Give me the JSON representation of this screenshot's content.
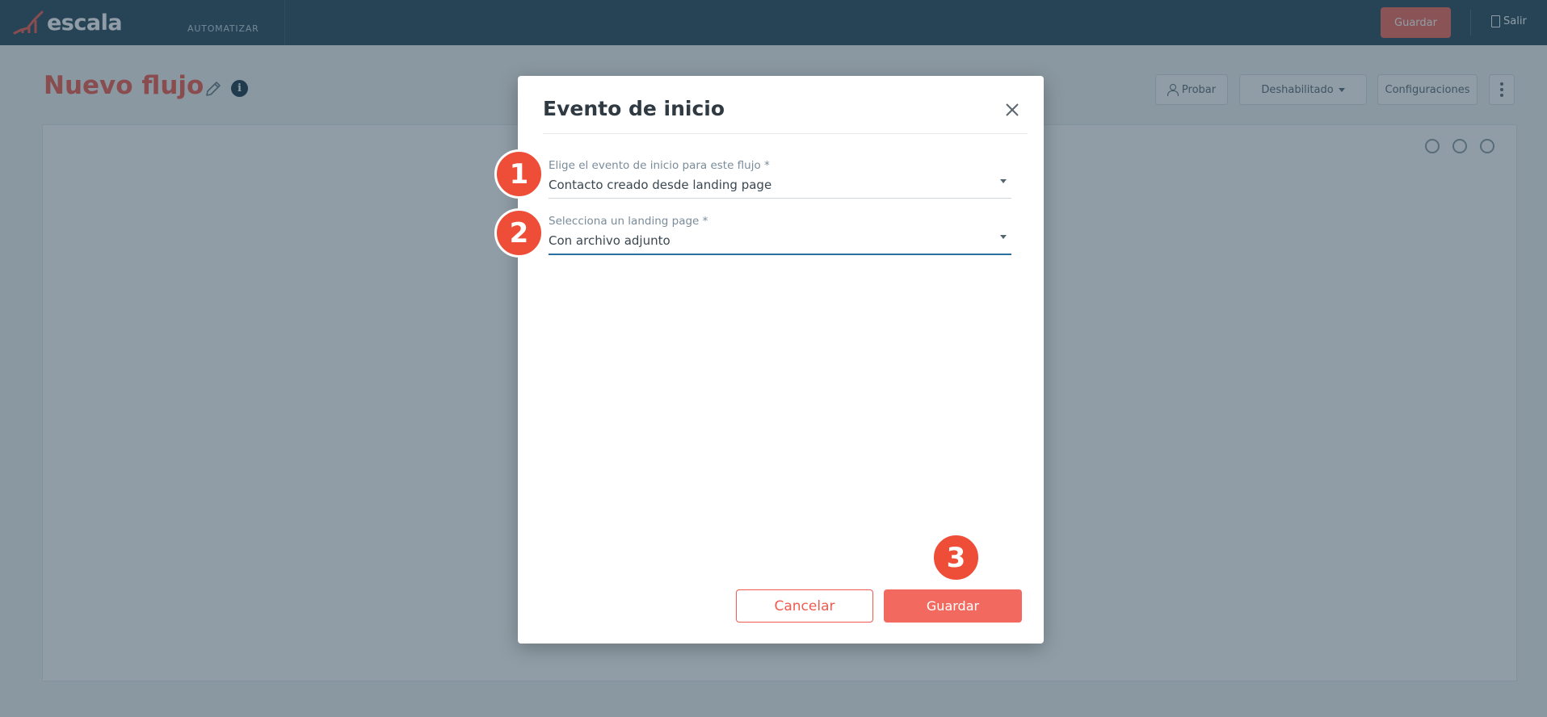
{
  "app": {
    "brand": "escala",
    "nav_item": "AUTOMATIZAR",
    "top_save_label": "Guardar",
    "logout_label": "Salir"
  },
  "page": {
    "title": "Nuevo flujo",
    "info_icon_glyph": "i",
    "buttons": {
      "probar": "Probar",
      "estado": "Deshabilitado",
      "config": "Configuraciones"
    }
  },
  "modal": {
    "title": "Evento de inicio",
    "fields": [
      {
        "label": "Elige el evento de inicio para este flujo *",
        "value": "Contacto creado desde landing page"
      },
      {
        "label": "Selecciona un landing page *",
        "value": "Con archivo adjunto"
      }
    ],
    "cancel_label": "Cancelar",
    "save_label": "Guardar"
  },
  "steps": [
    "1",
    "2",
    "3"
  ],
  "colors": {
    "topbar": "#2d4d60",
    "accent": "#f26a5f",
    "badge": "#ee4d37",
    "focus_line": "#2a6fa0"
  },
  "icons": [
    "logo-icon",
    "logout-icon",
    "edit-icon",
    "info-icon",
    "person-icon",
    "chevron-down-icon",
    "more-vertical-icon",
    "zoom-in-icon",
    "zoom-out-icon",
    "user-icon",
    "close-icon"
  ]
}
